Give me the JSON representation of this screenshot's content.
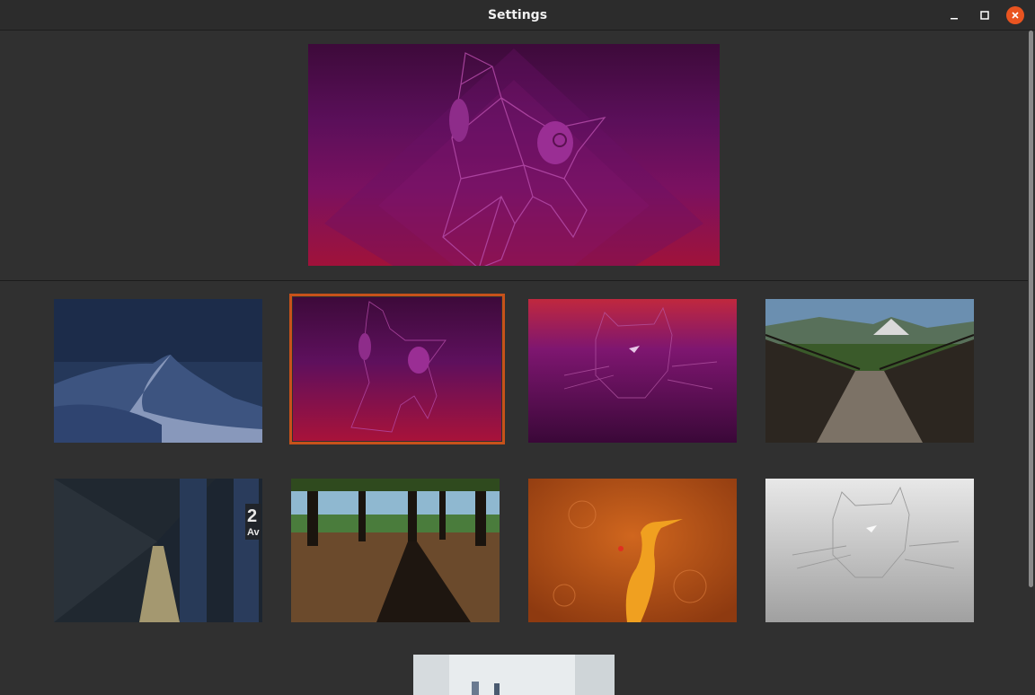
{
  "window": {
    "title": "Settings",
    "controls": {
      "minimize": "minimize",
      "maximize": "maximize",
      "close": "close"
    }
  },
  "colors": {
    "accent": "#e95420",
    "selection_border": "#c7521a",
    "window_bg": "#303030",
    "titlebar_bg": "#2c2c2c"
  },
  "background": {
    "current_preview": "focal-fossa-purple",
    "wallpapers": [
      {
        "name": "desert-dune",
        "selected": false
      },
      {
        "name": "focal-fossa-purple",
        "selected": true
      },
      {
        "name": "fossa-cat-purple",
        "selected": false
      },
      {
        "name": "suspension-bridge",
        "selected": false
      },
      {
        "name": "subway-station",
        "selected": false,
        "sign_text": "2 Av"
      },
      {
        "name": "forest-shadow",
        "selected": false
      },
      {
        "name": "orange-bird",
        "selected": false
      },
      {
        "name": "fossa-cat-grey",
        "selected": false
      },
      {
        "name": "bright-interior",
        "selected": false
      }
    ]
  }
}
